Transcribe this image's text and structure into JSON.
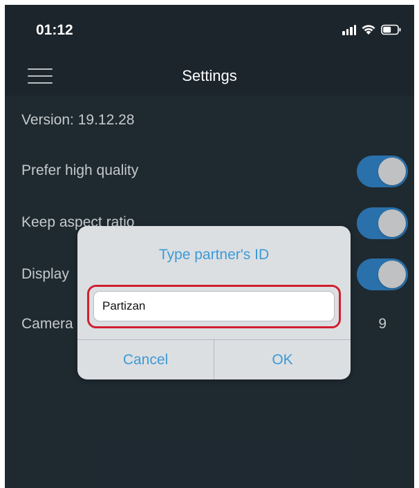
{
  "status_bar": {
    "time": "01:12",
    "icons": [
      "signal-icon",
      "wifi-icon",
      "battery-icon"
    ]
  },
  "nav": {
    "title": "Settings",
    "menu_icon": "hamburger-menu-icon"
  },
  "settings": {
    "version": "Version: 19.12.28",
    "prefer_high_quality": {
      "label": "Prefer high quality",
      "on": true
    },
    "keep_aspect_ratio": {
      "label": "Keep aspect ratio",
      "on": true
    },
    "display": {
      "label": "Display",
      "on": true
    },
    "camera": {
      "label": "Camera",
      "value": "9"
    }
  },
  "dialog": {
    "title": "Type partner's ID",
    "input_value": "Partizan",
    "cancel_label": "Cancel",
    "ok_label": "OK"
  },
  "colors": {
    "background": "#222d35",
    "bar": "#1c252c",
    "accent": "#3d9ad6",
    "toggle_on": "#2f7fc2",
    "highlight": "#d0202e"
  }
}
